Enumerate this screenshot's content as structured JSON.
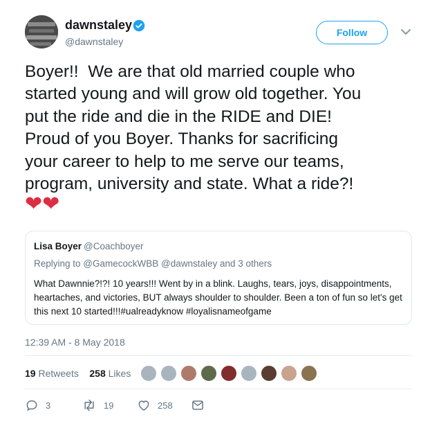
{
  "user": {
    "display_name": "dawnstaley",
    "handle": "@dawnstaley",
    "verified": true,
    "follow_label": "Follow"
  },
  "tweet": {
    "text": "Boyer!!  We are that old married couple who\nstarted young and will grow old together. You\nput the ride and die in the RIDE and DIE!\nProud of you Boyer. Thanks for sacrificing\nyour career to help to me serve our teams,\nprogram, university and state. What a ride?!",
    "emoji": "❤❤"
  },
  "quoted": {
    "name": "Lisa Boyer",
    "handle": "@Coachboyer",
    "replying_to": "Replying to @GamecockWBB @dawnstaley and 3 others",
    "text": "What Dawnnie?!?!  10 years!!!  Went by in a blink. Laughs, tears, joys, disappointments, heartaches, and victories, BUT always shoulder to shoulder.  Been a ton of fun so let's get this next 10 started!!!#ualreadyknow #loyalisnameofgame"
  },
  "meta": {
    "timestamp": "12:39 AM - 8 May 2018",
    "retweets_count": "19",
    "retweets_label": "Retweets",
    "likes_count": "258",
    "likes_label": "Likes"
  },
  "actions": {
    "reply_count": "3",
    "retweet_count": "19",
    "like_count": "258"
  },
  "colors": {
    "accent": "#1da1f2",
    "text": "#14171a",
    "muted": "#657786",
    "heart": "#dd2e44",
    "border": "#e1e8ed"
  },
  "icons": [
    "verified-badge-icon",
    "chevron-down-icon",
    "reply-icon",
    "retweet-icon",
    "like-icon",
    "direct-message-icon"
  ]
}
